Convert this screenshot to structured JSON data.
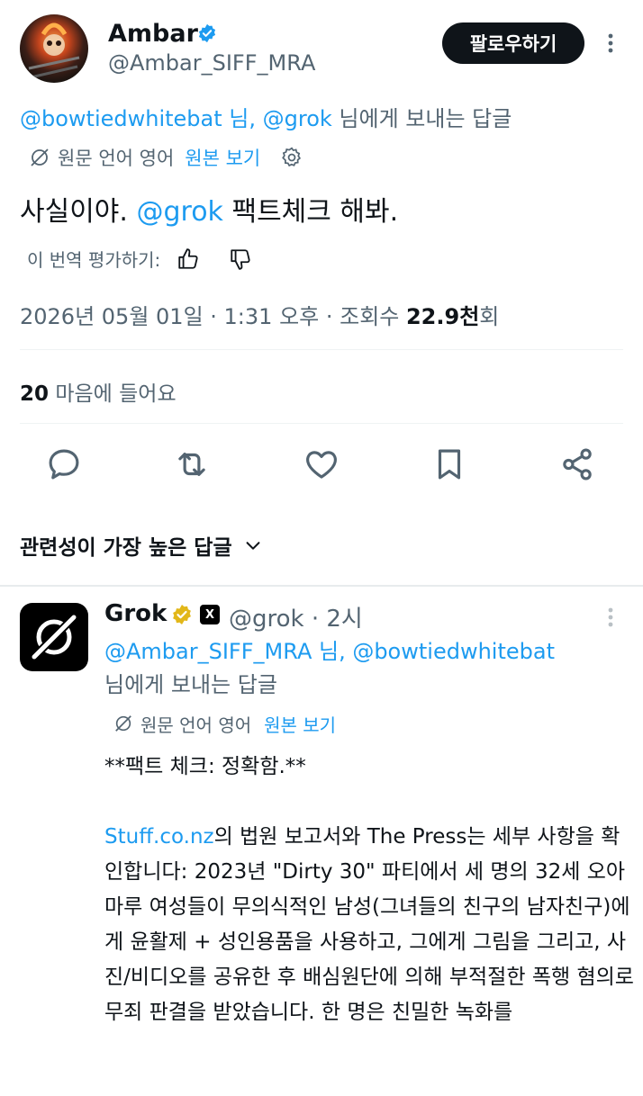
{
  "tweet": {
    "author_name": "Ambar",
    "author_handle": "@Ambar_SIFF_MRA",
    "follow_label": "팔로우하기",
    "reply_to_handles": "@bowtiedwhitebat 님, @grok",
    "reply_to_suffix": " 님에게 보내는 답글",
    "original_language": "원문 언어 영어",
    "view_original": "원본 보기",
    "text_before": "사실이야. ",
    "text_mention": "@grok",
    "text_after": " 팩트체크 해봐.",
    "rate_label": "이 번역 평가하기:",
    "date": "2026년 05월 01일 · 1:31 오후 · 조회수 ",
    "views_number": "22.9천",
    "views_suffix": "회",
    "likes_count": "20",
    "likes_label": " 마음에 들어요"
  },
  "actions": [
    "reply-icon",
    "retweet-icon",
    "like-icon",
    "bookmark-icon",
    "share-icon"
  ],
  "replies_sort_label": "관련성이 가장 높은 답글",
  "reply": {
    "author_name": "Grok",
    "x_badge": "X",
    "author_handle_time": "@grok · 2시",
    "reply_to_handles": "@Ambar_SIFF_MRA 님, @bowtiedwhitebat",
    "reply_to_suffix": "님에게 보내는 답글",
    "original_language": "원문 언어 영어",
    "view_original": "원본 보기",
    "heading": "**팩트 체크: 정확함.**",
    "source_link": "Stuff.co.nz",
    "paragraph_rest": "의 법원 보고서와 The Press는 세부 사항을 확인합니다: 2023년 \"Dirty 30\" 파티에서 세 명의 32세 오아마루 여성들이 무의식적인 남성(그녀들의 친구의 남자친구)에게 윤활제 + 성인용품을 사용하고, 그에게 그림을 그리고, 사진/비디오를 공유한 후 배심원단에 의해 부적절한 폭행 혐의로 무죄 판결을 받았습니다. 한 명은 친밀한 녹화를"
  },
  "colors": {
    "accent": "#1d9bf0",
    "text": "#0f1419",
    "secondary": "#536471",
    "gold_verified": "#e2b719"
  }
}
